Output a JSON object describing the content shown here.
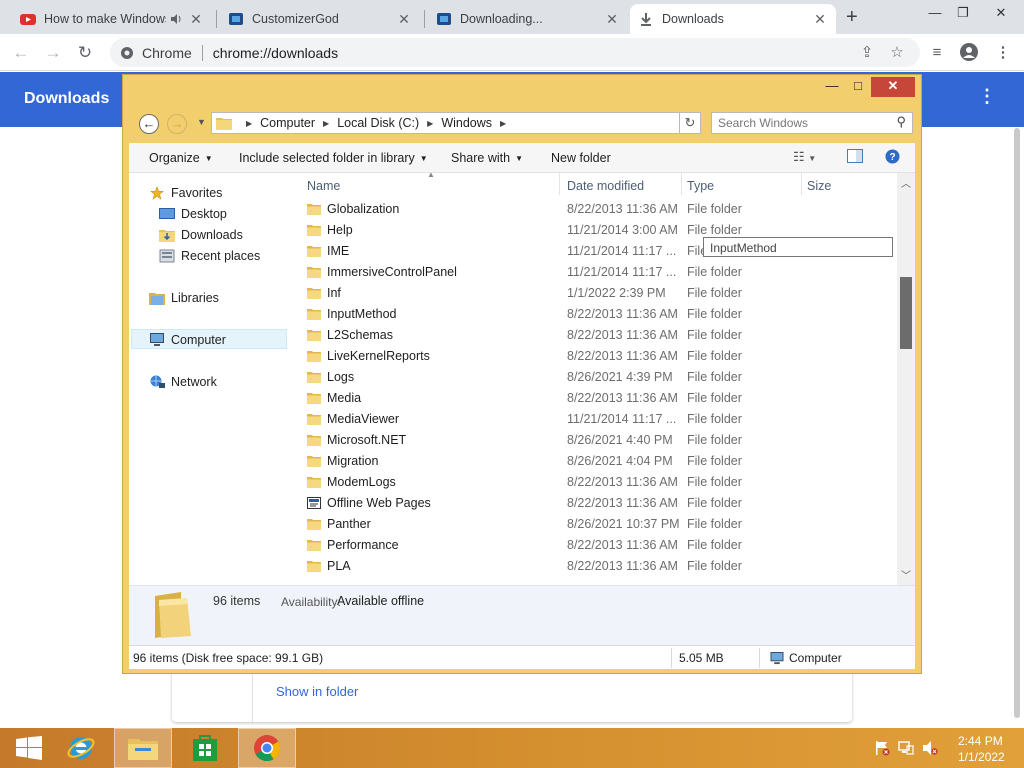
{
  "browser": {
    "tabs": [
      {
        "title": "How to make Windows",
        "favicon": "youtube-icon",
        "audio": true,
        "active": false
      },
      {
        "title": "CustomizerGod",
        "favicon": "customizergod-icon",
        "active": false
      },
      {
        "title": "Downloading...",
        "favicon": "customizergod-icon",
        "active": false
      },
      {
        "title": "Downloads",
        "favicon": "download-icon",
        "active": true
      }
    ],
    "new_tab_glyph": "+",
    "omnibox": {
      "chip": "Chrome",
      "url": "chrome://downloads"
    }
  },
  "downloads_page": {
    "title": "Downloads",
    "card_link": "Show in folder",
    "header_color": "#3367d6"
  },
  "explorer": {
    "address": {
      "crumbs": [
        "Computer",
        "Local Disk (C:)",
        "Windows"
      ]
    },
    "search_placeholder": "Search Windows",
    "commands": {
      "organize": "Organize",
      "include": "Include selected folder in library",
      "share": "Share with",
      "new_folder": "New folder"
    },
    "nav": {
      "favorites": "Favorites",
      "desktop": "Desktop",
      "downloads": "Downloads",
      "recent": "Recent places",
      "libraries": "Libraries",
      "computer": "Computer",
      "network": "Network"
    },
    "columns": {
      "name": "Name",
      "date": "Date modified",
      "type": "Type",
      "size": "Size"
    },
    "files": [
      {
        "name": "Globalization",
        "date": "8/22/2013 11:36 AM",
        "type": "File folder"
      },
      {
        "name": "Help",
        "date": "11/21/2014 3:00 AM",
        "type": "File folder"
      },
      {
        "name": "IME",
        "date": "11/21/2014 11:17 ...",
        "type": "File folder"
      },
      {
        "name": "ImmersiveControlPanel",
        "date": "11/21/2014 11:17 ...",
        "type": "File folder"
      },
      {
        "name": "Inf",
        "date": "1/1/2022 2:39 PM",
        "type": "File folder"
      },
      {
        "name": "InputMethod",
        "date": "8/22/2013 11:36 AM",
        "type": "File folder"
      },
      {
        "name": "L2Schemas",
        "date": "8/22/2013 11:36 AM",
        "type": "File folder"
      },
      {
        "name": "LiveKernelReports",
        "date": "8/22/2013 11:36 AM",
        "type": "File folder"
      },
      {
        "name": "Logs",
        "date": "8/26/2021 4:39 PM",
        "type": "File folder"
      },
      {
        "name": "Media",
        "date": "8/22/2013 11:36 AM",
        "type": "File folder"
      },
      {
        "name": "MediaViewer",
        "date": "11/21/2014 11:17 ...",
        "type": "File folder"
      },
      {
        "name": "Microsoft.NET",
        "date": "8/26/2021 4:40 PM",
        "type": "File folder"
      },
      {
        "name": "Migration",
        "date": "8/26/2021 4:04 PM",
        "type": "File folder"
      },
      {
        "name": "ModemLogs",
        "date": "8/22/2013 11:36 AM",
        "type": "File folder"
      },
      {
        "name": "Offline Web Pages",
        "date": "8/22/2013 11:36 AM",
        "type": "File folder"
      },
      {
        "name": "Panther",
        "date": "8/26/2021 10:37 PM",
        "type": "File folder"
      },
      {
        "name": "Performance",
        "date": "8/22/2013 11:36 AM",
        "type": "File folder"
      },
      {
        "name": "PLA",
        "date": "8/22/2013 11:36 AM",
        "type": "File folder"
      }
    ],
    "tooltip": "InputMethod",
    "details": {
      "count": "96 items",
      "availability_label": "Availability:",
      "availability_value": "Available offline"
    },
    "status": {
      "left": "96 items (Disk free space: 99.1 GB)",
      "size": "5.05 MB",
      "location": "Computer"
    }
  },
  "taskbar": {
    "items": [
      "start-button",
      "internet-explorer-icon",
      "file-explorer-icon",
      "store-icon",
      "chrome-icon"
    ],
    "clock": {
      "time": "2:44 PM",
      "date": "1/1/2022"
    }
  }
}
